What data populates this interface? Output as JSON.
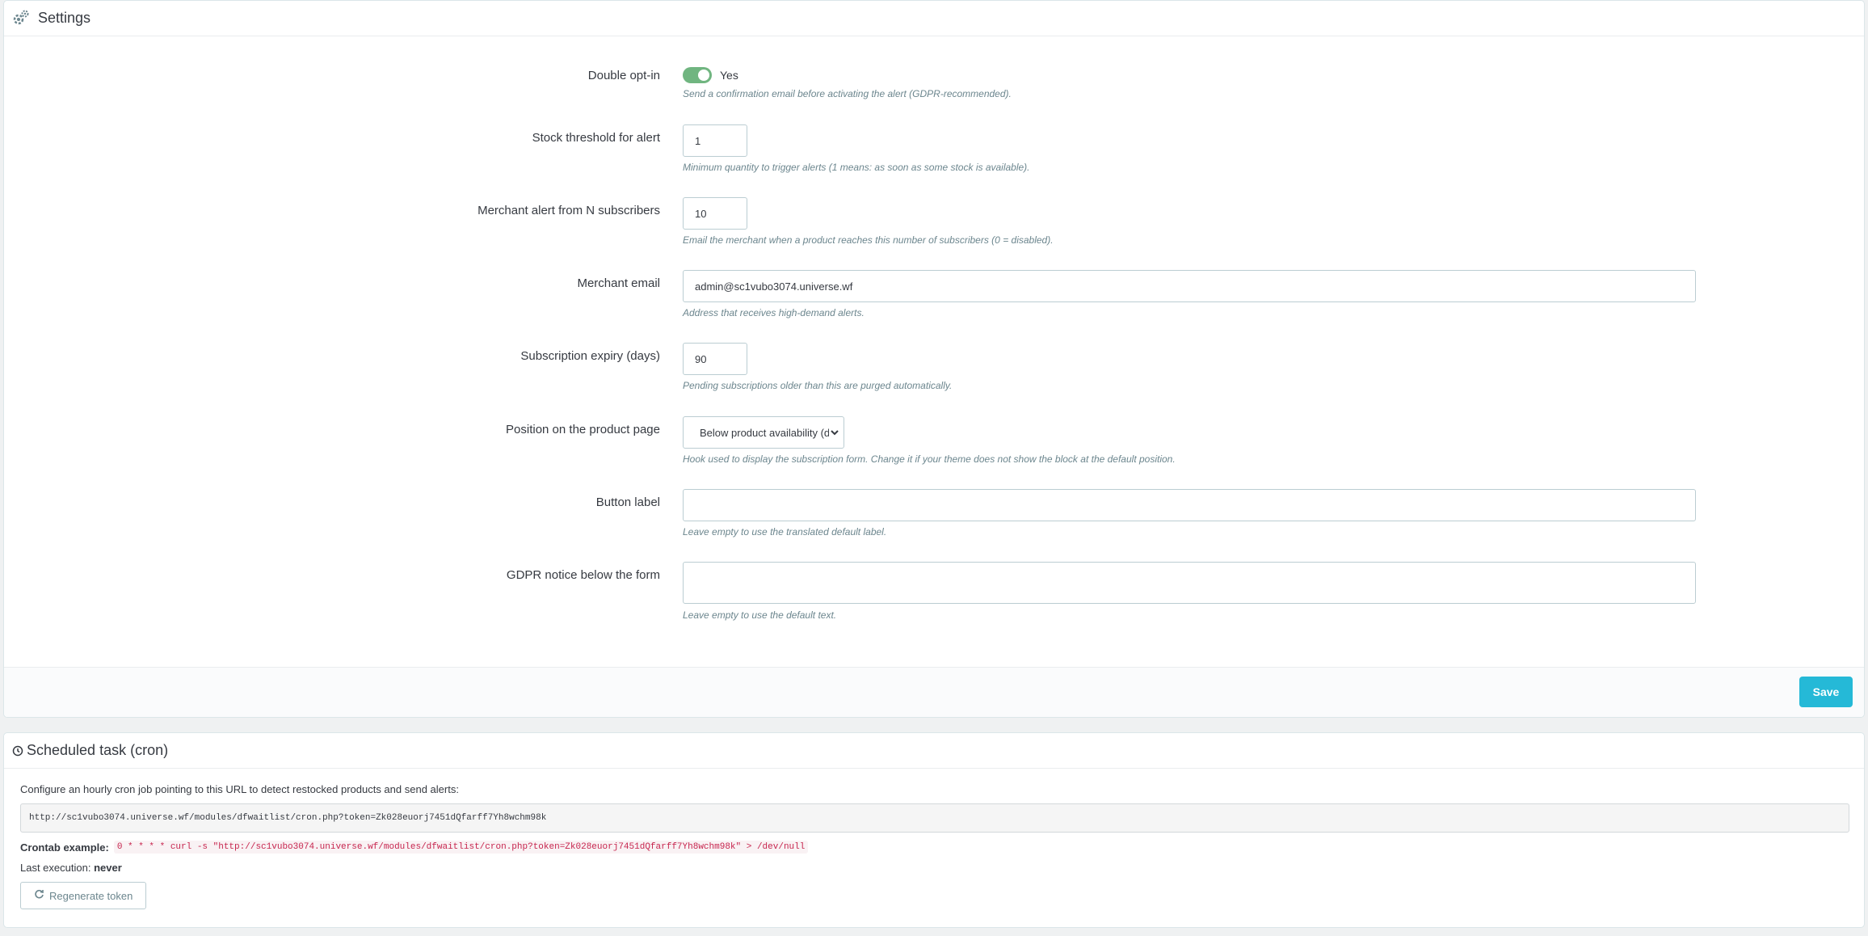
{
  "settings": {
    "title": "Settings",
    "icon": "cogs-icon",
    "double_optin": {
      "label": "Double opt-in",
      "value_text": "Yes",
      "enabled": true,
      "help": "Send a confirmation email before activating the alert (GDPR-recommended)."
    },
    "stock_threshold": {
      "label": "Stock threshold for alert",
      "value": "1",
      "help": "Minimum quantity to trigger alerts (1 means: as soon as some stock is available)."
    },
    "merchant_alert": {
      "label": "Merchant alert from N subscribers",
      "value": "10",
      "help": "Email the merchant when a product reaches this number of subscribers (0 = disabled)."
    },
    "merchant_email": {
      "label": "Merchant email",
      "value": "admin@sc1vubo3074.universe.wf",
      "help": "Address that receives high-demand alerts."
    },
    "subscription_expiry": {
      "label": "Subscription expiry (days)",
      "value": "90",
      "help": "Pending subscriptions older than this are purged automatically."
    },
    "position": {
      "label": "Position on the product page",
      "selected": "Below product availability (dis",
      "help": "Hook used to display the subscription form. Change it if your theme does not show the block at the default position."
    },
    "button_label": {
      "label": "Button label",
      "value": "",
      "help": "Leave empty to use the translated default label."
    },
    "gdpr_notice": {
      "label": "GDPR notice below the form",
      "value": "",
      "help": "Leave empty to use the default text."
    },
    "save_label": "Save"
  },
  "cron": {
    "title": "Scheduled task (cron)",
    "icon": "clock-icon",
    "description": "Configure an hourly cron job pointing to this URL to detect restocked products and send alerts:",
    "url": "http://sc1vubo3074.universe.wf/modules/dfwaitlist/cron.php?token=Zk028euorj7451dQfarff7Yh8wchm98k",
    "crontab_label": "Crontab example:",
    "crontab_code": "0 * * * * curl -s \"http://sc1vubo3074.universe.wf/modules/dfwaitlist/cron.php?token=Zk028euorj7451dQfarff7Yh8wchm98k\" > /dev/null",
    "last_execution_label": "Last execution:",
    "last_execution_value": "never",
    "regenerate_label": "Regenerate token",
    "regenerate_icon": "refresh-icon"
  },
  "colors": {
    "accent": "#25b9d7",
    "switch_on": "#70b580",
    "help_text": "#6c868e",
    "code_text": "#c7254e"
  }
}
